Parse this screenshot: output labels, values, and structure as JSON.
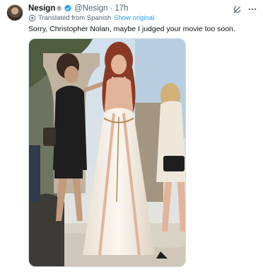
{
  "tweet": {
    "display_name": "Nesign",
    "registered_mark": "®",
    "handle": "@Nesign",
    "separator": "·",
    "time": "17h",
    "translation_note": "Translated from Spanish",
    "show_original_label": "Show original",
    "text": "Sorry, Christopher Nolan, maybe I judged your movie too soon."
  },
  "icons": {
    "verified": "verified-badge-icon",
    "translate": "translate-icon",
    "grok": "grok-icon",
    "more": "more-icon"
  },
  "colors": {
    "accent": "#1d9bf0",
    "secondary_text": "#536471",
    "primary_text": "#0f1419"
  }
}
